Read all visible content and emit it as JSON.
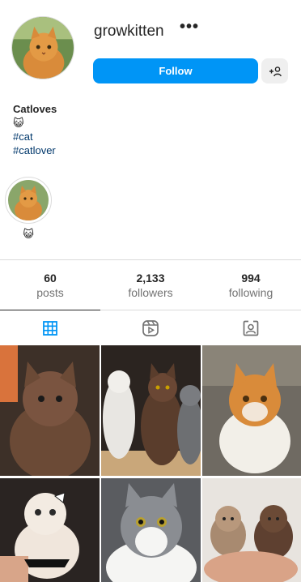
{
  "profile": {
    "username": "growkitten",
    "more_label": "•••",
    "follow_label": "Follow",
    "suggest_icon": "add-person-icon"
  },
  "bio": {
    "name": "Catloves",
    "emoji": "😺",
    "tags": [
      "#cat",
      "#catlover"
    ]
  },
  "highlights": [
    {
      "label": "😺"
    }
  ],
  "stats": [
    {
      "value": "60",
      "label": "posts"
    },
    {
      "value": "2,133",
      "label": "followers"
    },
    {
      "value": "994",
      "label": "following"
    }
  ],
  "tabs": [
    {
      "icon": "grid-icon",
      "active": true
    },
    {
      "icon": "reels-icon",
      "active": false
    },
    {
      "icon": "tagged-icon",
      "active": false
    }
  ],
  "colors": {
    "primary": "#0095f6",
    "text": "#262626",
    "muted": "#737373",
    "link": "#00376b",
    "border": "#dbdbdb"
  }
}
